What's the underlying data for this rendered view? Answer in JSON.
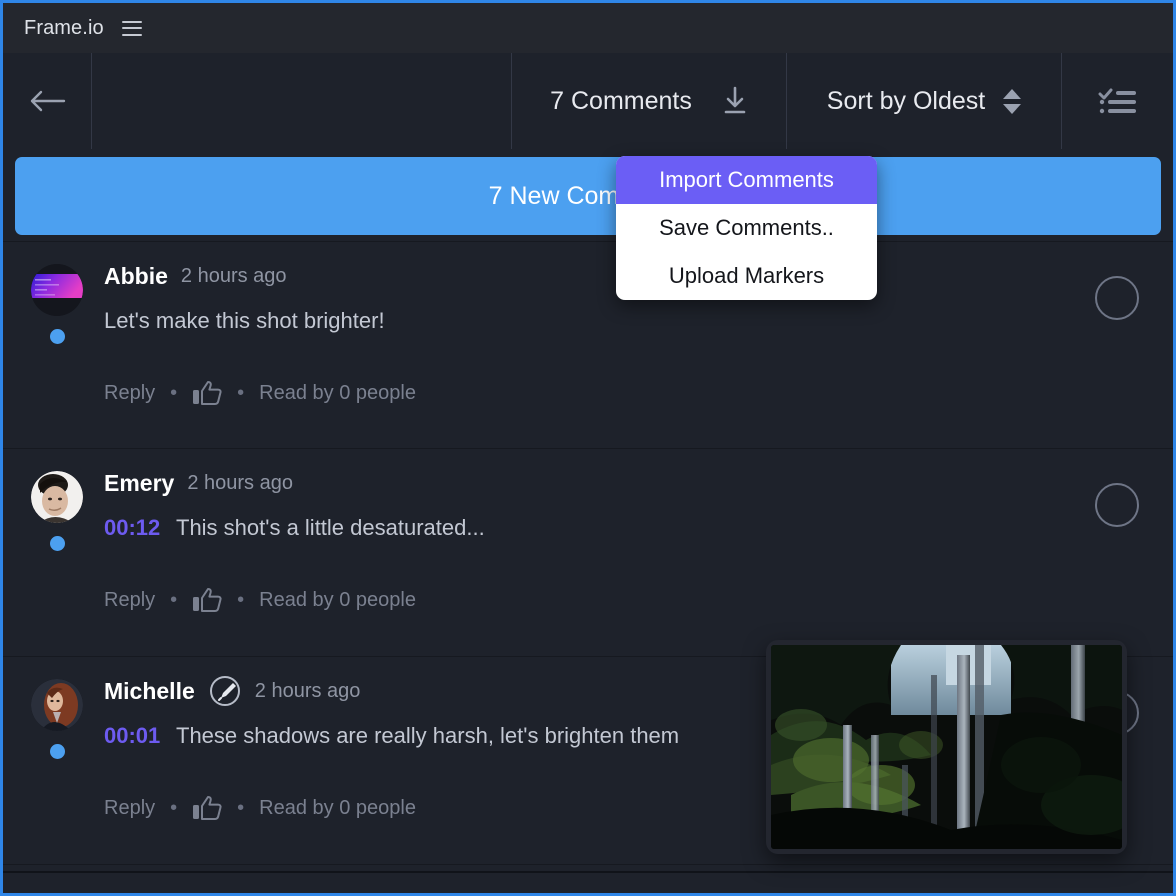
{
  "window": {
    "accent_border": "#2f86e8"
  },
  "titlebar": {
    "brand": "Frame.io",
    "menu_icon": "hamburger-icon"
  },
  "toolbar": {
    "back_icon": "back-arrow-icon",
    "comments_count_label": "7 Comments",
    "download_icon": "download-icon",
    "sort_label": "Sort by Oldest",
    "stepper_icon": "up-down-stepper-icon",
    "checklist_icon": "checklist-icon"
  },
  "banner": {
    "label": "7 New Comments",
    "color": "#4ca0f0",
    "text_color": "#ffffff"
  },
  "dropdown": {
    "highlight_color": "#6b5ef5",
    "items": [
      {
        "label": "Import Comments",
        "active": true
      },
      {
        "label": "Save Comments..",
        "active": false
      },
      {
        "label": "Upload Markers",
        "active": false
      }
    ]
  },
  "comments": [
    {
      "author": "Abbie",
      "time": "2 hours ago",
      "timestamp": "",
      "text": "Let's make this shot brighter!",
      "reply_label": "Reply",
      "like_icon": "thumbs-up-icon",
      "read_label": "Read by 0 people",
      "unread": true,
      "has_annotation": false,
      "avatar": "abbie-avatar"
    },
    {
      "author": "Emery",
      "time": "2 hours ago",
      "timestamp": "00:12",
      "text": "This shot's a little desaturated...",
      "reply_label": "Reply",
      "like_icon": "thumbs-up-icon",
      "read_label": "Read by 0 people",
      "unread": true,
      "has_annotation": false,
      "avatar": "emery-avatar"
    },
    {
      "author": "Michelle",
      "time": "2 hours ago",
      "timestamp": "00:01",
      "text": "These shadows are really harsh, let's brighten them",
      "reply_label": "Reply",
      "like_icon": "thumbs-up-icon",
      "read_label": "Read by 0 people",
      "unread": true,
      "has_annotation": true,
      "avatar": "michelle-avatar"
    }
  ],
  "preview": {
    "name": "video-frame-preview",
    "description": "dark forest with tall trees"
  },
  "separators": {
    "dot": "•"
  }
}
